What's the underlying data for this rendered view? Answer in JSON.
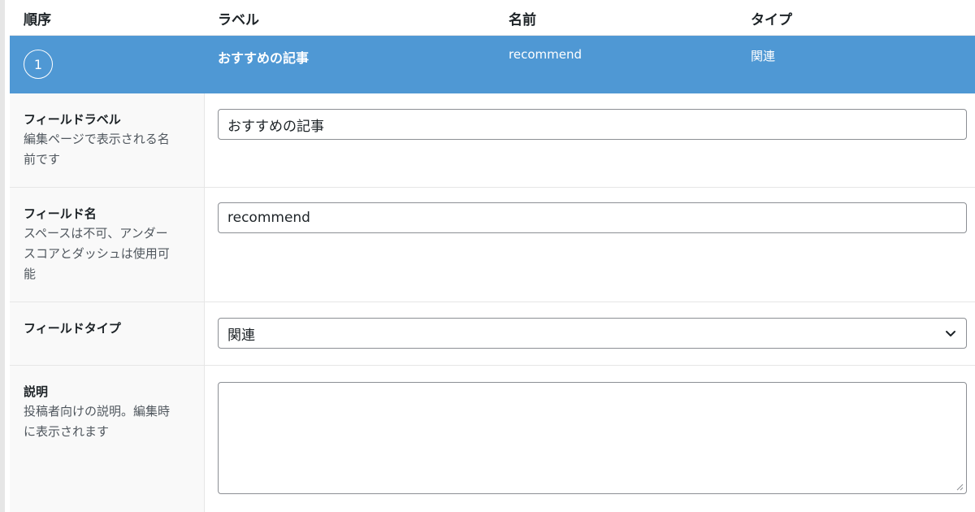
{
  "header": {
    "order": "順序",
    "label": "ラベル",
    "name": "名前",
    "type": "タイプ"
  },
  "selected_field": {
    "order": "1",
    "label": "おすすめの記事",
    "name": "recommend",
    "type": "関連"
  },
  "settings": {
    "field_label": {
      "title": "フィールドラベル",
      "desc_line1": "編集ページで表示される名",
      "desc_line2": "前です",
      "value": "おすすめの記事"
    },
    "field_name": {
      "title": "フィールド名",
      "desc_line1": "スペースは不可、アンダー",
      "desc_line2": "スコアとダッシュは使用可",
      "desc_line3": "能",
      "value": "recommend"
    },
    "field_type": {
      "title": "フィールドタイプ",
      "selected": "関連"
    },
    "instructions": {
      "title": "説明",
      "desc_line1": "投稿者向けの説明。編集時",
      "desc_line2": "に表示されます",
      "value": ""
    }
  },
  "colors": {
    "selected_row": "#4f98d4",
    "label_column": "#f9f9f9",
    "input_border": "#8c8f94"
  }
}
